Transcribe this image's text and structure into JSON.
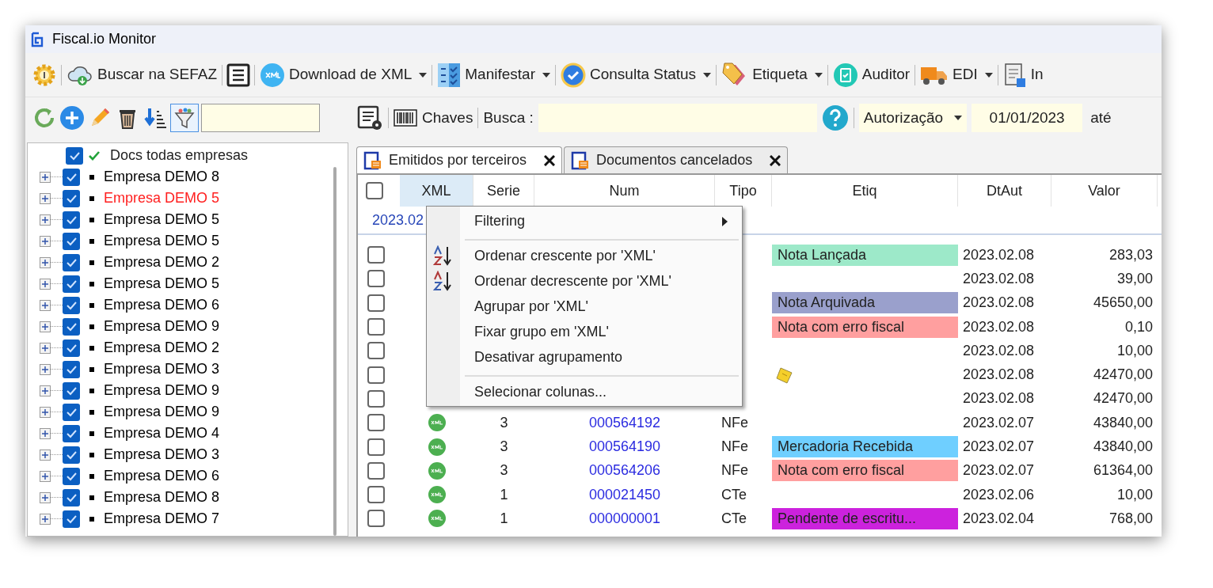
{
  "window": {
    "title": "Fiscal.io Monitor"
  },
  "toolbar": [
    {
      "kind": "icon"
    },
    {
      "kind": "button",
      "label": "Buscar na SEFAZ",
      "dropdown": false
    },
    {
      "kind": "icon"
    },
    {
      "kind": "button",
      "label": "Download de XML",
      "dropdown": true
    },
    {
      "kind": "button",
      "label": "Manifestar",
      "dropdown": true
    },
    {
      "kind": "button",
      "label": "Consulta Status",
      "dropdown": true
    },
    {
      "kind": "button",
      "label": "Etiqueta",
      "dropdown": true
    },
    {
      "kind": "button",
      "label": "Auditor",
      "dropdown": false
    },
    {
      "kind": "button",
      "label": "EDI",
      "dropdown": true
    },
    {
      "kind": "button",
      "label": "In",
      "dropdown": false
    }
  ],
  "search_bar": {
    "keys_label": "Chaves",
    "search_label": "Busca :",
    "date_type": "Autorização",
    "date_from": "01/01/2023",
    "until_label": "até"
  },
  "tree": {
    "label": "Docs todas empresas",
    "checked": true,
    "children": [
      {
        "label": "Empresa DEMO 8",
        "checked": true,
        "expanded": false,
        "color": "#000000"
      },
      {
        "label": "Empresa DEMO 5",
        "checked": true,
        "expanded": false,
        "color": "#ff2020"
      },
      {
        "label": "Empresa DEMO 5",
        "checked": true,
        "expanded": false,
        "color": "#000000"
      },
      {
        "label": "Empresa DEMO 5",
        "checked": true,
        "expanded": false,
        "color": "#000000"
      },
      {
        "label": "Empresa DEMO 2",
        "checked": true,
        "expanded": false,
        "color": "#000000"
      },
      {
        "label": "Empresa DEMO 5",
        "checked": true,
        "expanded": false,
        "color": "#000000"
      },
      {
        "label": "Empresa DEMO 6",
        "checked": true,
        "expanded": false,
        "color": "#000000"
      },
      {
        "label": "Empresa DEMO 9",
        "checked": true,
        "expanded": false,
        "color": "#000000"
      },
      {
        "label": "Empresa DEMO 2",
        "checked": true,
        "expanded": false,
        "color": "#000000"
      },
      {
        "label": "Empresa DEMO 3",
        "checked": true,
        "expanded": false,
        "color": "#000000"
      },
      {
        "label": "Empresa DEMO 9",
        "checked": true,
        "expanded": false,
        "color": "#000000"
      },
      {
        "label": "Empresa DEMO 9",
        "checked": true,
        "expanded": false,
        "color": "#000000"
      },
      {
        "label": "Empresa DEMO 4",
        "checked": true,
        "expanded": false,
        "color": "#000000"
      },
      {
        "label": "Empresa DEMO 3",
        "checked": true,
        "expanded": false,
        "color": "#000000"
      },
      {
        "label": "Empresa DEMO 6",
        "checked": true,
        "expanded": false,
        "color": "#000000"
      },
      {
        "label": "Empresa DEMO 8",
        "checked": true,
        "expanded": false,
        "color": "#000000"
      },
      {
        "label": "Empresa DEMO 7",
        "checked": true,
        "expanded": false,
        "color": "#000000"
      }
    ]
  },
  "tabs": [
    {
      "label": "Emitidos por terceiros",
      "selected": true
    },
    {
      "label": "Documentos cancelados",
      "selected": false
    }
  ],
  "table": {
    "all_checked": false,
    "columns": [
      {
        "label": "XML",
        "selected": true
      },
      {
        "label": "Serie",
        "selected": false
      },
      {
        "label": "Num",
        "selected": false
      },
      {
        "label": "Tipo",
        "selected": false
      },
      {
        "label": "Etiq",
        "selected": false
      },
      {
        "label": "DtAut",
        "selected": false
      },
      {
        "label": "Valor",
        "selected": false
      }
    ],
    "group_row": "2023.02",
    "rows": [
      {
        "checked": false,
        "etiq": {
          "kind": "tag",
          "label": "Nota Lançada",
          "color": "#9de9c9"
        },
        "dtaut": "2023.02.08",
        "valor": "283,03"
      },
      {
        "checked": false,
        "dtaut": "2023.02.08",
        "valor": "39,00"
      },
      {
        "checked": false,
        "etiq": {
          "kind": "tag",
          "label": "Nota Arquivada",
          "color": "#9aa0cc"
        },
        "dtaut": "2023.02.08",
        "valor": "45650,00"
      },
      {
        "checked": false,
        "etiq": {
          "kind": "tag",
          "label": "Nota com erro fiscal",
          "color": "#ff9f9f"
        },
        "dtaut": "2023.02.08",
        "valor": "0,10"
      },
      {
        "checked": false,
        "dtaut": "2023.02.08",
        "valor": "10,00"
      },
      {
        "checked": false,
        "etiq": {
          "kind": "note"
        },
        "dtaut": "2023.02.08",
        "valor": "42470,00"
      },
      {
        "checked": false,
        "dtaut": "2023.02.08",
        "valor": "42470,00"
      },
      {
        "checked": false,
        "xml": true,
        "serie": "3",
        "num": "000564192",
        "tipo": "NFe",
        "dtaut": "2023.02.07",
        "valor": "43840,00"
      },
      {
        "checked": false,
        "xml": true,
        "serie": "3",
        "num": "000564190",
        "tipo": "NFe",
        "etiq": {
          "kind": "tag",
          "label": "Mercadoria Recebida",
          "color": "#6fcfff"
        },
        "dtaut": "2023.02.07",
        "valor": "43840,00"
      },
      {
        "checked": false,
        "xml": true,
        "serie": "3",
        "num": "000564206",
        "tipo": "NFe",
        "etiq": {
          "kind": "tag",
          "label": "Nota com erro fiscal",
          "color": "#ff9f9f"
        },
        "dtaut": "2023.02.07",
        "valor": "61364,00"
      },
      {
        "checked": false,
        "xml": true,
        "serie": "1",
        "num": "000021450",
        "tipo": "CTe",
        "dtaut": "2023.02.06",
        "valor": "10,00"
      },
      {
        "checked": false,
        "xml": true,
        "serie": "1",
        "num": "000000001",
        "tipo": "CTe",
        "etiq": {
          "kind": "tag",
          "label": "Pendente de escritu...",
          "color": "#cc22dd"
        },
        "dtaut": "2023.02.04",
        "valor": "768,00"
      }
    ]
  },
  "context_menu": [
    {
      "kind": "submenu",
      "label": "Filtering"
    },
    {
      "kind": "separator"
    },
    {
      "kind": "sort_asc",
      "label": "Ordenar crescente por 'XML'"
    },
    {
      "kind": "sort_desc",
      "label": "Ordenar decrescente por 'XML'"
    },
    {
      "kind": "plain",
      "label": "Agrupar por 'XML'"
    },
    {
      "kind": "plain",
      "label": "Fixar  grupo em 'XML'"
    },
    {
      "kind": "plain",
      "label": "Desativar agrupamento"
    },
    {
      "kind": "separator"
    },
    {
      "kind": "plain",
      "label": "Selecionar colunas..."
    }
  ]
}
